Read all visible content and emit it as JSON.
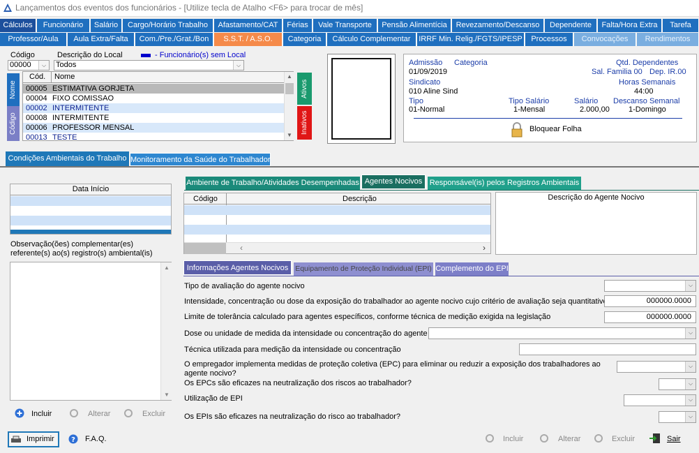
{
  "window": {
    "title": "Lançamentos dos eventos dos funcionários - [Utilize tecla de Atalho <F6> para trocar de mês]"
  },
  "tabs_row1": [
    "Cálculos",
    "Funcionário",
    "Salário",
    "Cargo/Horário Trabalho",
    "Afastamento/CAT",
    "Férias",
    "Vale Transporte",
    "Pensão Alimentícia",
    "Revezamento/Descanso",
    "Dependente",
    "Falta/Hora Extra",
    "Tarefa"
  ],
  "tabs_row2": [
    "Professor/Aula",
    "Aula Extra/Falta",
    "Com./Pre./Grat./Bon",
    "S.S.T. / A.S.O.",
    "Categoria",
    "Cálculo Complementar",
    "IRRF Min. Relig./FGTS/IPESP",
    "Processos",
    "Convocações",
    "Rendimentos"
  ],
  "filter": {
    "codigo_label": "Código",
    "codigo_value": "00000",
    "descricao_label": "Descrição do Local",
    "descricao_value": "Todos",
    "legend": "- Funcionário(s) sem Local",
    "legend_color": "#0000cc"
  },
  "employees": {
    "col_cod": "Cód.",
    "col_nome": "Nome",
    "rows": [
      {
        "cod": "00005",
        "nome": "ESTIMATIVA GORJETA"
      },
      {
        "cod": "00004",
        "nome": "FIXO COMISSAO"
      },
      {
        "cod": "00002",
        "nome": "INTERMITENTE"
      },
      {
        "cod": "00008",
        "nome": "INTERMITENTE"
      },
      {
        "cod": "00006",
        "nome": "PROFESSOR MENSAL"
      },
      {
        "cod": "00013",
        "nome": "TESTE"
      }
    ],
    "vtab_nome": "Nome",
    "vtab_codigo": "Código",
    "vtab_ativos": "Ativos",
    "vtab_inativos": "Inativos"
  },
  "info": {
    "admissao_label": "Admissão",
    "admissao_value": "01/09/2019",
    "categoria_label": "Categoria",
    "qtd_dep_label": "Qtd. Dependentes",
    "sal_familia": "Sal. Familia 00",
    "dep_ir": "Dep. IR.00",
    "sindicato_label": "Sindicato",
    "sindicato_value": "010  Aline Sind",
    "horas_label": "Horas Semanais",
    "horas_value": "44:00",
    "tipo_label": "Tipo",
    "tipo_value": "01-Normal",
    "tipo_sal_label": "Tipo Salário",
    "tipo_sal_value": "1-Mensal",
    "salario_label": "Salário",
    "salario_value": "2.000,00",
    "descanso_label": "Descanso Semanal",
    "descanso_value": "1-Domingo",
    "bloquear": "Bloquear Folha"
  },
  "section_tabs": {
    "t1": "Condições Ambientais do Trabalho",
    "t2": "Monitoramento da Saúde do Trabalhador"
  },
  "left": {
    "data_inicio": "Data Início",
    "obs_label": "Observação(ões) complementar(es) referente(s) ao(s) registro(s) ambiental(is)",
    "incluir": "Incluir",
    "alterar": "Alterar",
    "excluir": "Excluir"
  },
  "sub_tabs": {
    "a": "Ambiente de Trabalho/Atividades Desempenhadas",
    "b": "Agentes Nocivos",
    "c": "Responsável(is) pelos Registros Ambientais"
  },
  "agentes": {
    "col_codigo": "Código",
    "col_descricao": "Descrição",
    "desc_title": "Descrição do Agente Nocivo"
  },
  "info_tabs": {
    "a": "Informações Agentes Nocivos",
    "b": "Equipamento de Proteção Individual (EPI)",
    "c": "Complemento do EPI"
  },
  "form": {
    "q1": "Tipo de avaliação do agente nocivo",
    "q2": "Intensidade, concentração ou dose da exposição do trabalhador ao agente nocivo cujo critério de avaliação seja quantitativo",
    "q2_value": "000000.0000",
    "q3": "Limite de tolerância calculado para agentes específicos, conforme técnica de medição exigida na legislação",
    "q3_value": "000000.0000",
    "q4": "Dose ou unidade de medida da intensidade ou concentração do agente",
    "q5": "Técnica utilizada para medição da intensidade ou concentração",
    "q6": "O empregador implementa medidas de proteção coletiva (EPC) para eliminar ou reduzir a exposição dos trabalhadores ao agente nocivo?",
    "q7": "Os EPCs são eficazes na neutralização dos riscos ao trabalhador?",
    "q8": "Utilização de EPI",
    "q9": "Os EPIs são eficazes na neutralização do risco ao trabalhador?"
  },
  "bottom": {
    "imprimir": "Imprimir",
    "faq": "F.A.Q.",
    "incluir": "Incluir",
    "alterar": "Alterar",
    "excluir": "Excluir",
    "sair": "Sair"
  }
}
